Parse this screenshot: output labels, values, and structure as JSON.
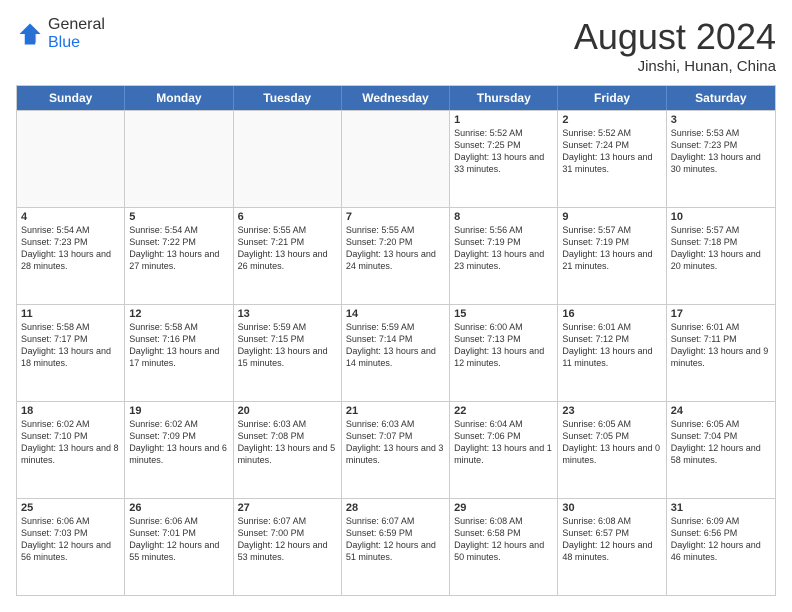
{
  "logo": {
    "general": "General",
    "blue": "Blue"
  },
  "title": {
    "month": "August 2024",
    "location": "Jinshi, Hunan, China"
  },
  "header_days": [
    "Sunday",
    "Monday",
    "Tuesday",
    "Wednesday",
    "Thursday",
    "Friday",
    "Saturday"
  ],
  "rows": [
    [
      {
        "day": "",
        "empty": true
      },
      {
        "day": "",
        "empty": true
      },
      {
        "day": "",
        "empty": true
      },
      {
        "day": "",
        "empty": true
      },
      {
        "day": "1",
        "sunrise": "Sunrise: 5:52 AM",
        "sunset": "Sunset: 7:25 PM",
        "daylight": "Daylight: 13 hours and 33 minutes."
      },
      {
        "day": "2",
        "sunrise": "Sunrise: 5:52 AM",
        "sunset": "Sunset: 7:24 PM",
        "daylight": "Daylight: 13 hours and 31 minutes."
      },
      {
        "day": "3",
        "sunrise": "Sunrise: 5:53 AM",
        "sunset": "Sunset: 7:23 PM",
        "daylight": "Daylight: 13 hours and 30 minutes."
      }
    ],
    [
      {
        "day": "4",
        "sunrise": "Sunrise: 5:54 AM",
        "sunset": "Sunset: 7:23 PM",
        "daylight": "Daylight: 13 hours and 28 minutes."
      },
      {
        "day": "5",
        "sunrise": "Sunrise: 5:54 AM",
        "sunset": "Sunset: 7:22 PM",
        "daylight": "Daylight: 13 hours and 27 minutes."
      },
      {
        "day": "6",
        "sunrise": "Sunrise: 5:55 AM",
        "sunset": "Sunset: 7:21 PM",
        "daylight": "Daylight: 13 hours and 26 minutes."
      },
      {
        "day": "7",
        "sunrise": "Sunrise: 5:55 AM",
        "sunset": "Sunset: 7:20 PM",
        "daylight": "Daylight: 13 hours and 24 minutes."
      },
      {
        "day": "8",
        "sunrise": "Sunrise: 5:56 AM",
        "sunset": "Sunset: 7:19 PM",
        "daylight": "Daylight: 13 hours and 23 minutes."
      },
      {
        "day": "9",
        "sunrise": "Sunrise: 5:57 AM",
        "sunset": "Sunset: 7:19 PM",
        "daylight": "Daylight: 13 hours and 21 minutes."
      },
      {
        "day": "10",
        "sunrise": "Sunrise: 5:57 AM",
        "sunset": "Sunset: 7:18 PM",
        "daylight": "Daylight: 13 hours and 20 minutes."
      }
    ],
    [
      {
        "day": "11",
        "sunrise": "Sunrise: 5:58 AM",
        "sunset": "Sunset: 7:17 PM",
        "daylight": "Daylight: 13 hours and 18 minutes."
      },
      {
        "day": "12",
        "sunrise": "Sunrise: 5:58 AM",
        "sunset": "Sunset: 7:16 PM",
        "daylight": "Daylight: 13 hours and 17 minutes."
      },
      {
        "day": "13",
        "sunrise": "Sunrise: 5:59 AM",
        "sunset": "Sunset: 7:15 PM",
        "daylight": "Daylight: 13 hours and 15 minutes."
      },
      {
        "day": "14",
        "sunrise": "Sunrise: 5:59 AM",
        "sunset": "Sunset: 7:14 PM",
        "daylight": "Daylight: 13 hours and 14 minutes."
      },
      {
        "day": "15",
        "sunrise": "Sunrise: 6:00 AM",
        "sunset": "Sunset: 7:13 PM",
        "daylight": "Daylight: 13 hours and 12 minutes."
      },
      {
        "day": "16",
        "sunrise": "Sunrise: 6:01 AM",
        "sunset": "Sunset: 7:12 PM",
        "daylight": "Daylight: 13 hours and 11 minutes."
      },
      {
        "day": "17",
        "sunrise": "Sunrise: 6:01 AM",
        "sunset": "Sunset: 7:11 PM",
        "daylight": "Daylight: 13 hours and 9 minutes."
      }
    ],
    [
      {
        "day": "18",
        "sunrise": "Sunrise: 6:02 AM",
        "sunset": "Sunset: 7:10 PM",
        "daylight": "Daylight: 13 hours and 8 minutes."
      },
      {
        "day": "19",
        "sunrise": "Sunrise: 6:02 AM",
        "sunset": "Sunset: 7:09 PM",
        "daylight": "Daylight: 13 hours and 6 minutes."
      },
      {
        "day": "20",
        "sunrise": "Sunrise: 6:03 AM",
        "sunset": "Sunset: 7:08 PM",
        "daylight": "Daylight: 13 hours and 5 minutes."
      },
      {
        "day": "21",
        "sunrise": "Sunrise: 6:03 AM",
        "sunset": "Sunset: 7:07 PM",
        "daylight": "Daylight: 13 hours and 3 minutes."
      },
      {
        "day": "22",
        "sunrise": "Sunrise: 6:04 AM",
        "sunset": "Sunset: 7:06 PM",
        "daylight": "Daylight: 13 hours and 1 minute."
      },
      {
        "day": "23",
        "sunrise": "Sunrise: 6:05 AM",
        "sunset": "Sunset: 7:05 PM",
        "daylight": "Daylight: 13 hours and 0 minutes."
      },
      {
        "day": "24",
        "sunrise": "Sunrise: 6:05 AM",
        "sunset": "Sunset: 7:04 PM",
        "daylight": "Daylight: 12 hours and 58 minutes."
      }
    ],
    [
      {
        "day": "25",
        "sunrise": "Sunrise: 6:06 AM",
        "sunset": "Sunset: 7:03 PM",
        "daylight": "Daylight: 12 hours and 56 minutes."
      },
      {
        "day": "26",
        "sunrise": "Sunrise: 6:06 AM",
        "sunset": "Sunset: 7:01 PM",
        "daylight": "Daylight: 12 hours and 55 minutes."
      },
      {
        "day": "27",
        "sunrise": "Sunrise: 6:07 AM",
        "sunset": "Sunset: 7:00 PM",
        "daylight": "Daylight: 12 hours and 53 minutes."
      },
      {
        "day": "28",
        "sunrise": "Sunrise: 6:07 AM",
        "sunset": "Sunset: 6:59 PM",
        "daylight": "Daylight: 12 hours and 51 minutes."
      },
      {
        "day": "29",
        "sunrise": "Sunrise: 6:08 AM",
        "sunset": "Sunset: 6:58 PM",
        "daylight": "Daylight: 12 hours and 50 minutes."
      },
      {
        "day": "30",
        "sunrise": "Sunrise: 6:08 AM",
        "sunset": "Sunset: 6:57 PM",
        "daylight": "Daylight: 12 hours and 48 minutes."
      },
      {
        "day": "31",
        "sunrise": "Sunrise: 6:09 AM",
        "sunset": "Sunset: 6:56 PM",
        "daylight": "Daylight: 12 hours and 46 minutes."
      }
    ]
  ]
}
